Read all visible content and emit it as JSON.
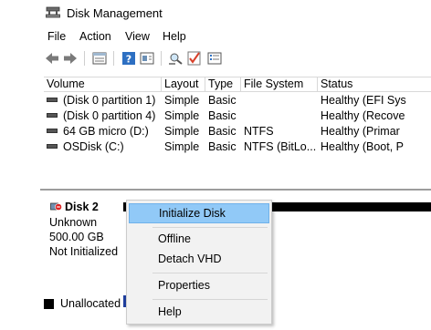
{
  "app": {
    "title": "Disk Management",
    "icon": "disk-management-icon"
  },
  "menubar": {
    "items": [
      "File",
      "Action",
      "View",
      "Help"
    ]
  },
  "toolbar": {
    "buttons": [
      "back-arrow-icon",
      "forward-arrow-icon",
      "disk-list-icon",
      "help-icon",
      "properties-icon",
      "rescan-icon",
      "check-icon",
      "settings-list-icon"
    ]
  },
  "volume_table": {
    "columns": [
      "Volume",
      "Layout",
      "Type",
      "File System",
      "Status"
    ],
    "rows": [
      {
        "volume": "(Disk 0 partition 1)",
        "layout": "Simple",
        "type": "Basic",
        "fs": "",
        "status": "Healthy (EFI Sys"
      },
      {
        "volume": "(Disk 0 partition 4)",
        "layout": "Simple",
        "type": "Basic",
        "fs": "",
        "status": "Healthy (Recove"
      },
      {
        "volume": "64 GB micro (D:)",
        "layout": "Simple",
        "type": "Basic",
        "fs": "NTFS",
        "status": "Healthy (Primar"
      },
      {
        "volume": "OSDisk (C:)",
        "layout": "Simple",
        "type": "Basic",
        "fs": "NTFS (BitLo...",
        "status": "Healthy (Boot, P"
      }
    ]
  },
  "disk": {
    "name": "Disk 2",
    "kind": "Unknown",
    "size": "500.00 GB",
    "state": "Not Initialized"
  },
  "legend": {
    "unallocated": "Unallocated"
  },
  "context_menu": {
    "items": [
      "Initialize Disk",
      "Offline",
      "Detach VHD",
      "Properties",
      "Help"
    ],
    "highlighted": "Initialize Disk"
  },
  "colors": {
    "highlight": "#91c9f7",
    "menu_bg": "#f2f2f2"
  }
}
